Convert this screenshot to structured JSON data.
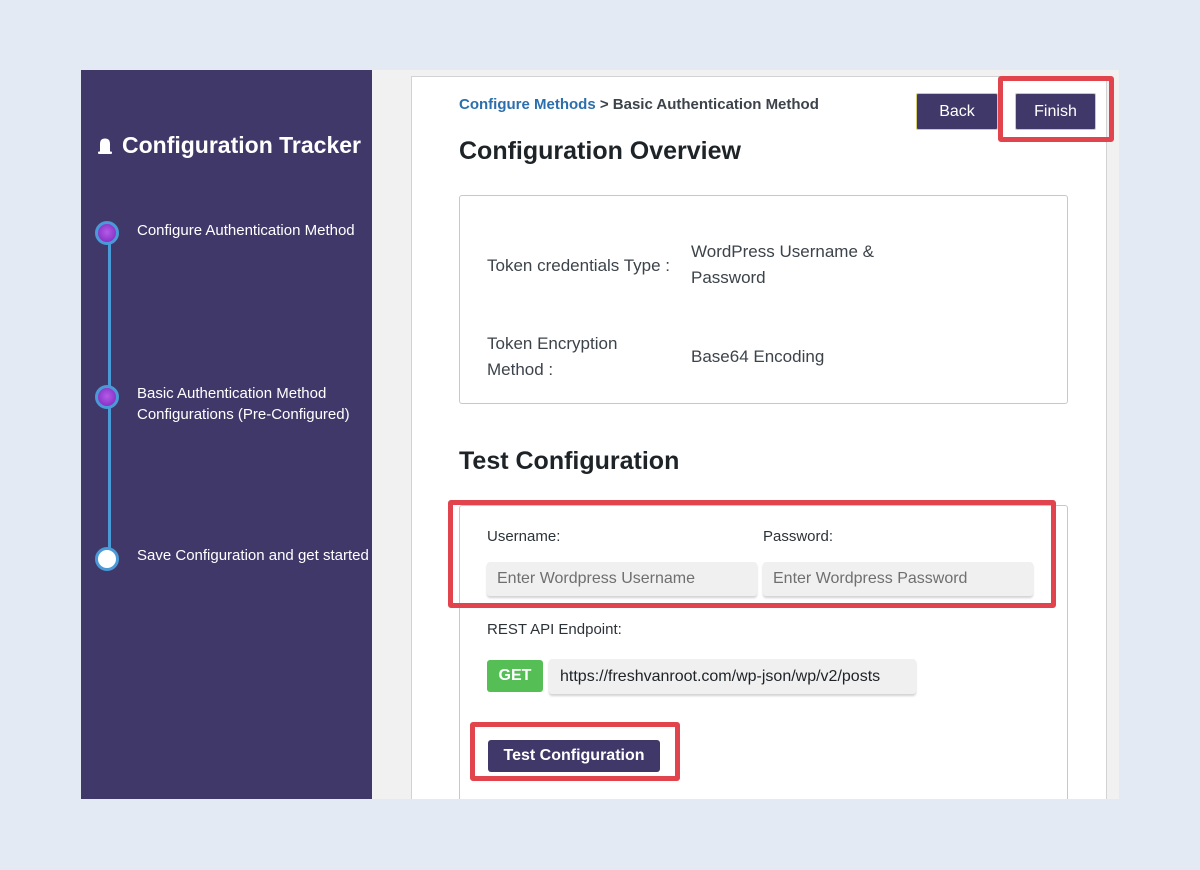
{
  "sidebar": {
    "title": "Configuration Tracker",
    "steps": [
      {
        "label": "Configure Authentication Method",
        "status": "done"
      },
      {
        "label": "Basic Authentication Method Configurations (Pre-Configured)",
        "status": "done"
      },
      {
        "label": "Save Configuration and get started",
        "status": "pending"
      }
    ]
  },
  "header": {
    "breadcrumb_link": "Configure Methods",
    "breadcrumb_separator": " > ",
    "breadcrumb_current": "Basic Authentication Method",
    "back_label": "Back",
    "finish_label": "Finish"
  },
  "overview": {
    "title": "Configuration Overview",
    "rows": [
      {
        "label": "Token credentials Type :",
        "value": "WordPress Username & Password"
      },
      {
        "label": "Token Encryption Method :",
        "value": "Base64 Encoding"
      }
    ]
  },
  "test": {
    "title": "Test Configuration",
    "username_label": "Username:",
    "username_placeholder": "Enter Wordpress Username",
    "password_label": "Password:",
    "password_placeholder": "Enter Wordpress Password",
    "endpoint_label": "REST API Endpoint:",
    "method": "GET",
    "endpoint_url": "https://freshvanroot.com/wp-json/wp/v2/posts",
    "button_label": "Test Configuration"
  },
  "colors": {
    "sidebar_bg": "#41386a",
    "accent_dark": "#41386a",
    "get_badge": "#55bf55",
    "highlight": "#e2444d",
    "link": "#2b6fad"
  }
}
